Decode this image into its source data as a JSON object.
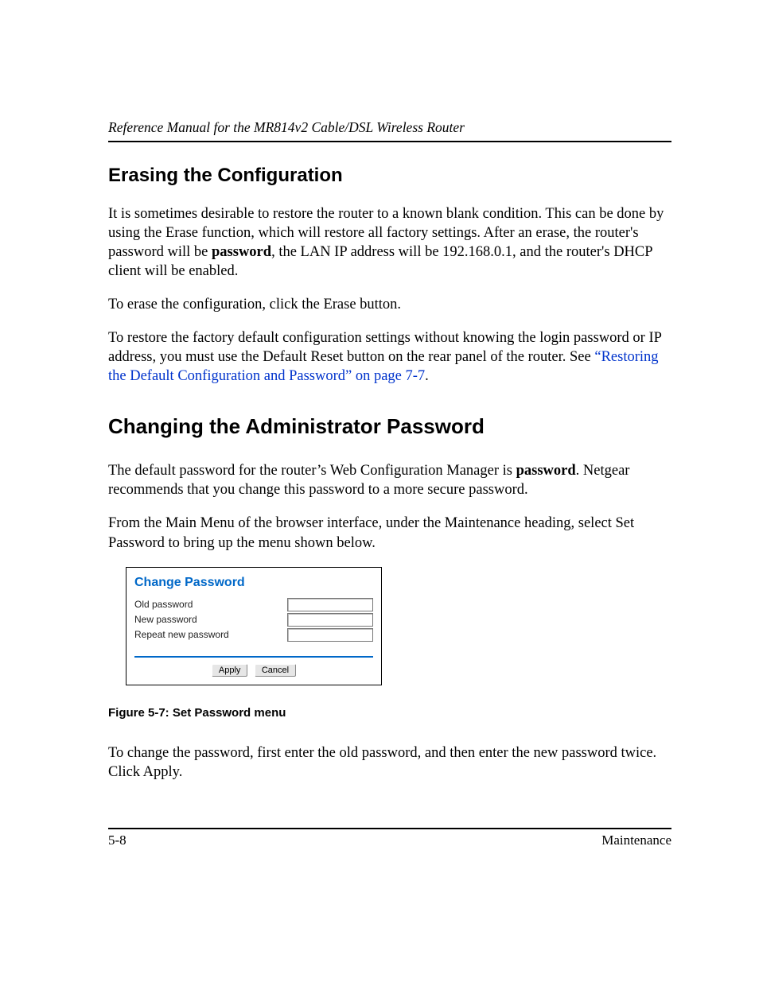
{
  "header": {
    "running_title": "Reference Manual for the MR814v2 Cable/DSL Wireless Router"
  },
  "section1": {
    "heading": "Erasing the Configuration",
    "p1a": "It is sometimes desirable to restore the router to a known blank condition. This can be done by using the Erase function, which will restore all factory settings. After an erase, the router's password will be ",
    "p1b_bold": "password",
    "p1c": ", the LAN IP address will be 192.168.0.1, and the router's DHCP client will be enabled.",
    "p2": "To erase the configuration, click the Erase button.",
    "p3a": "To restore the factory default configuration settings without knowing the login password or IP address, you must use the Default Reset button on the rear panel of the router. See ",
    "p3_link": "“Restoring the Default Configuration and Password” on page 7-7",
    "p3b": "."
  },
  "section2": {
    "heading": "Changing the Administrator Password",
    "p1a": "The default password for the router’s Web Configuration Manager is ",
    "p1b_bold": "password",
    "p1c": ". Netgear recommends that you change this password to a more secure password.",
    "p2": "From the Main Menu of the browser interface, under the Maintenance heading, select Set Password to bring up the menu shown below."
  },
  "panel": {
    "title": "Change Password",
    "rows": {
      "old": {
        "label": "Old password"
      },
      "new": {
        "label": "New password"
      },
      "repeat": {
        "label": "Repeat new password"
      }
    },
    "buttons": {
      "apply": "Apply",
      "cancel": "Cancel"
    }
  },
  "figure": {
    "caption": "Figure 5-7:  Set Password menu"
  },
  "closing": {
    "p1": "To change the password, first enter the old password, and then enter the new password twice. Click Apply."
  },
  "footer": {
    "left": "5-8",
    "right": "Maintenance"
  }
}
